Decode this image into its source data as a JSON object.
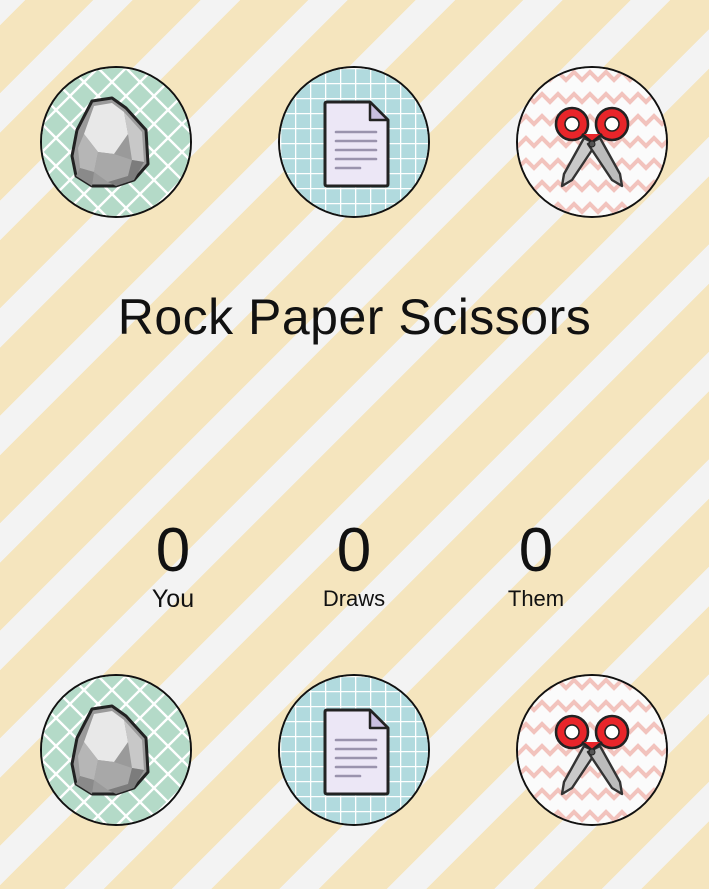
{
  "title": "Rock Paper Scissors",
  "top_choices": [
    {
      "name": "rock",
      "icon": "rock-icon",
      "bg_color": "#b4dac8"
    },
    {
      "name": "paper",
      "icon": "paper-icon",
      "bg_color": "#b1dade"
    },
    {
      "name": "scissors",
      "icon": "scissors-icon",
      "bg_color": "#f6c9c4"
    }
  ],
  "bottom_choices": [
    {
      "name": "rock",
      "icon": "rock-icon",
      "bg_color": "#b4dac8"
    },
    {
      "name": "paper",
      "icon": "paper-icon",
      "bg_color": "#b1dade"
    },
    {
      "name": "scissors",
      "icon": "scissors-icon",
      "bg_color": "#f6c9c4"
    }
  ],
  "scores": {
    "you": {
      "value": "0",
      "label": "You"
    },
    "draws": {
      "value": "0",
      "label": "Draws"
    },
    "them": {
      "value": "0",
      "label": "Them"
    }
  },
  "colors": {
    "stripe_yellow": "#f5e5be",
    "stripe_white": "#f3f3f3",
    "scissors_red": "#e8252a",
    "text": "#111111"
  }
}
